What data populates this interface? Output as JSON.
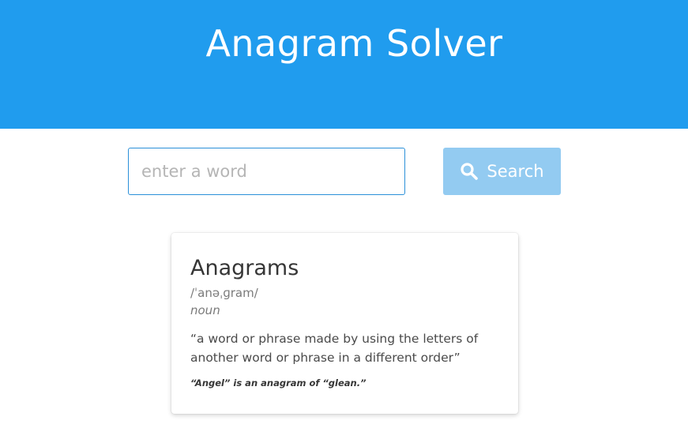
{
  "header": {
    "title": "Anagram Solver",
    "background_color": "#209cee"
  },
  "search": {
    "placeholder": "enter a word",
    "value": "",
    "button_label": "Search",
    "button_icon": "search-icon",
    "button_color": "#93cbf1"
  },
  "definition_card": {
    "title": "Anagrams",
    "pronunciation": "/ˈanəˌɡram/",
    "part_of_speech": "noun",
    "definition": "“a word or phrase made by using the letters of another word or phrase in a different order”",
    "example": "“Angel” is an anagram of “glean.”"
  }
}
